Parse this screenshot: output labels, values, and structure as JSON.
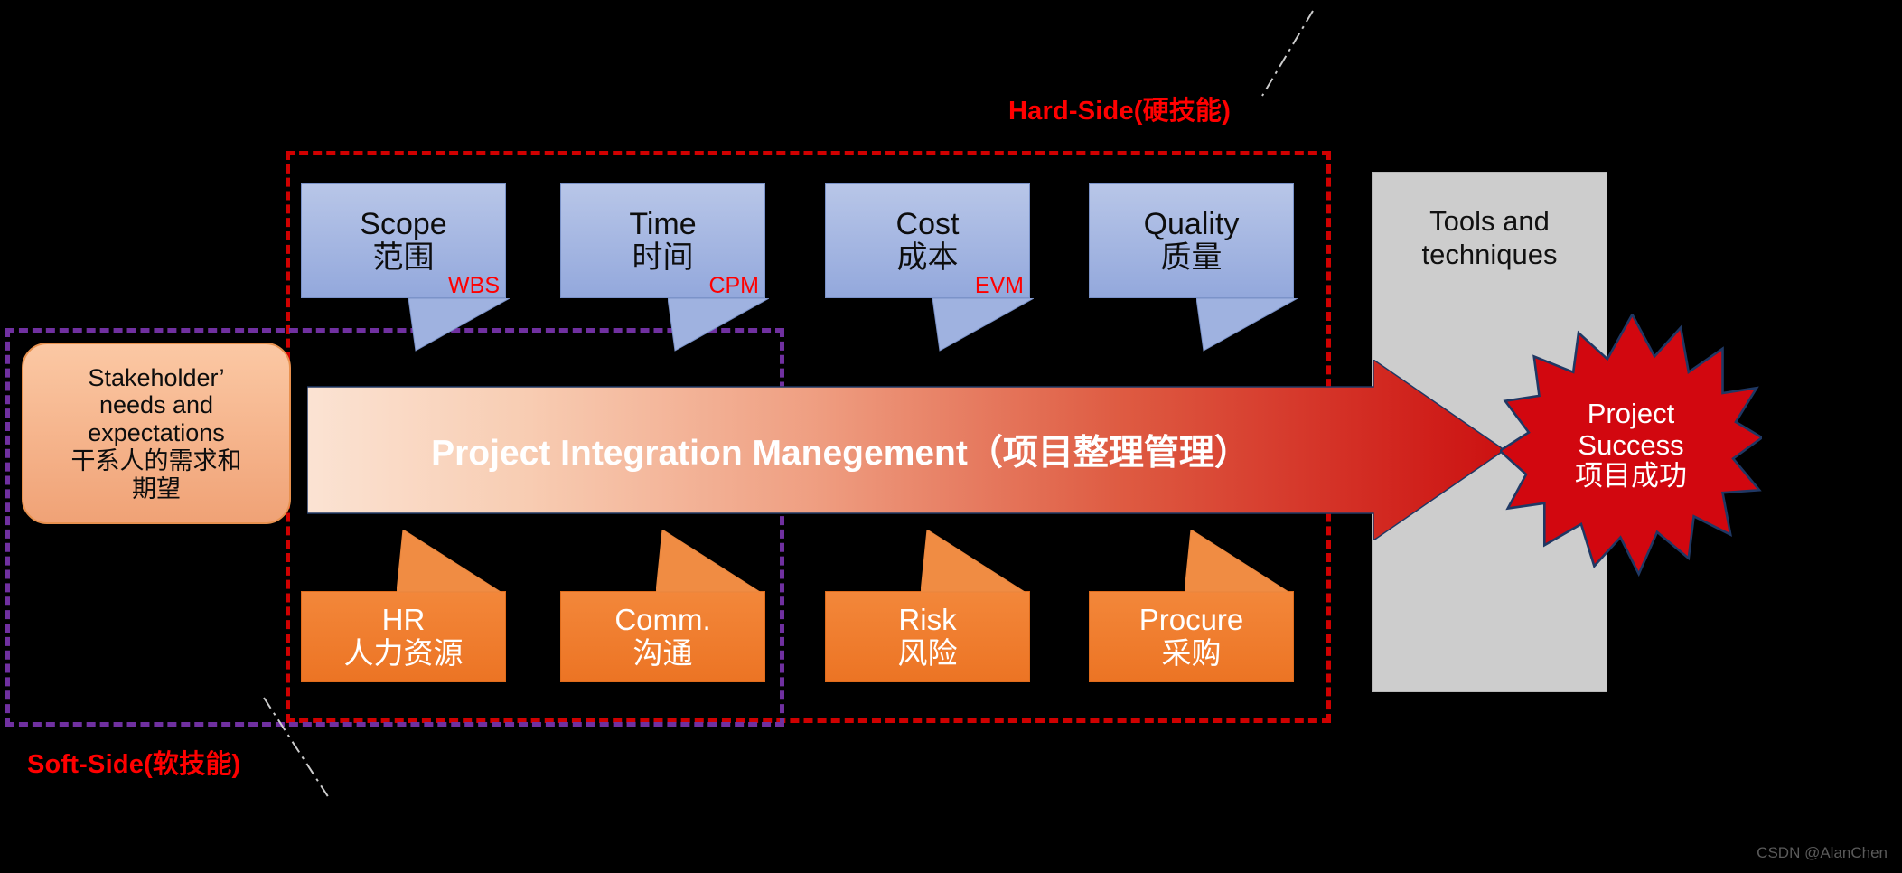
{
  "meta": {
    "watermark": "CSDN @AlanChen"
  },
  "groups": {
    "hard": {
      "label": "Hard-Side(硬技能)",
      "color": "#ff0000",
      "border_color": "#d00000"
    },
    "soft": {
      "label": "Soft-Side(软技能)",
      "color": "#ff0000",
      "border_color": "#7030a0"
    }
  },
  "stakeholder": {
    "line1": "Stakeholder’",
    "line2": "needs and",
    "line3": "expectations",
    "line4": "干系人的需求和",
    "line5": "期望"
  },
  "hard_skills": [
    {
      "en": "Scope",
      "zh": "范围",
      "acronym": "WBS"
    },
    {
      "en": "Time",
      "zh": "时间",
      "acronym": "CPM"
    },
    {
      "en": "Cost",
      "zh": "成本",
      "acronym": "EVM"
    },
    {
      "en": "Quality",
      "zh": "质量",
      "acronym": ""
    }
  ],
  "soft_skills": [
    {
      "en": "HR",
      "zh": "人力资源"
    },
    {
      "en": "Comm.",
      "zh": "沟通"
    },
    {
      "en": "Risk",
      "zh": "风险"
    },
    {
      "en": "Procure",
      "zh": "采购"
    }
  ],
  "arrow": {
    "label": "Project Integration Manegement（项目整理管理）",
    "gradient_start": "#fbe0cf",
    "gradient_end": "#cc1111"
  },
  "tools": {
    "line1": "Tools and",
    "line2": "techniques",
    "fill": "#cdcdcd"
  },
  "success": {
    "line1": "Project",
    "line2": "Success",
    "line3": "项目成功",
    "fill": "#d2070f",
    "stroke": "#1f3864"
  },
  "colors": {
    "blue_box": "#aabbe4",
    "orange_box": "#ed7d31",
    "peach_box": "#f6b183",
    "accent_red": "#ff0000",
    "purple": "#7030a0"
  }
}
